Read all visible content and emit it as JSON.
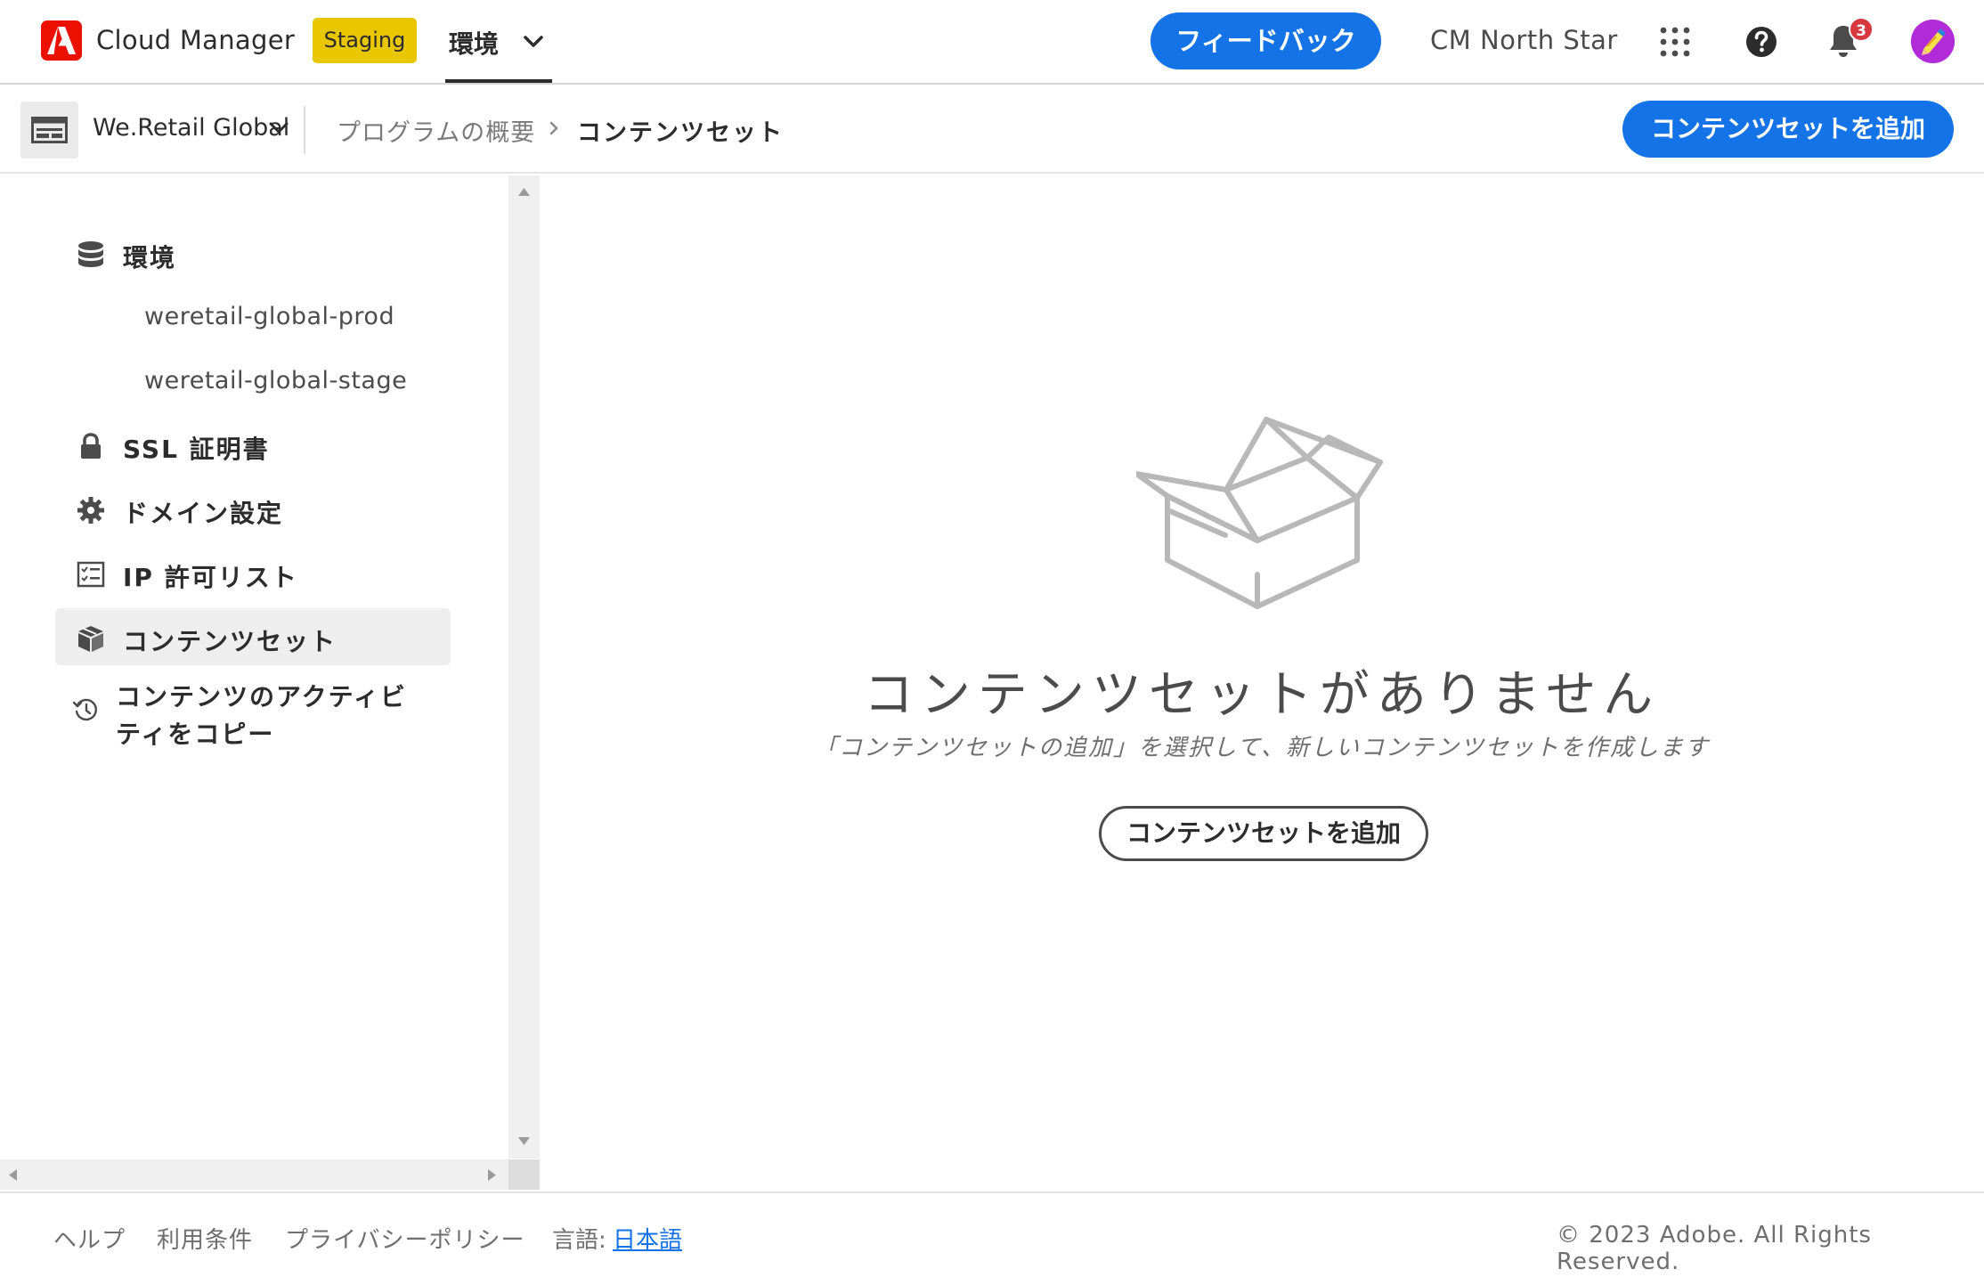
{
  "topbar": {
    "app_name": "Cloud Manager",
    "staging_badge": "Staging",
    "env_tab": "環境",
    "feedback_label": "フィードバック",
    "org_name": "CM North Star",
    "notification_count": "3",
    "icons": [
      "adobe-logo",
      "chevron-down-icon",
      "apps-grid-icon",
      "help-icon",
      "bell-icon",
      "avatar"
    ],
    "colors": {
      "brand_red": "#eb1000",
      "accent_blue": "#1473e6",
      "staging_yellow": "#e8c600",
      "badge_red": "#d7373f"
    }
  },
  "subheader": {
    "program_name": "We.Retail Global",
    "breadcrumb_parent": "プログラムの概要",
    "breadcrumb_current": "コンテンツセット",
    "add_button": "コンテンツセットを追加"
  },
  "sidebar": {
    "environments": {
      "label": "環境",
      "icon": "database-icon"
    },
    "env_items": [
      "weretail-global-prod",
      "weretail-global-stage"
    ],
    "ssl": {
      "label": "SSL 証明書",
      "icon": "lock-icon"
    },
    "domain": {
      "label": "ドメイン設定",
      "icon": "gear-icon"
    },
    "ip": {
      "label": "IP 許可リスト",
      "icon": "checklist-icon"
    },
    "content_sets": {
      "label": "コンテンツセット",
      "icon": "box-icon"
    },
    "copy_activity": {
      "label": "コンテンツのアクティビティをコピー",
      "icon": "history-icon"
    }
  },
  "main": {
    "empty_title": "コンテンツセットがありません",
    "empty_desc": "「コンテンツセットの追加」を選択して、新しいコンテンツセットを作成します",
    "empty_button": "コンテンツセットを追加"
  },
  "footer": {
    "help": "ヘルプ",
    "terms": "利用条件",
    "privacy": "プライバシーポリシー",
    "lang_label": "言語:",
    "lang_value": "日本語",
    "copyright": "© 2023 Adobe. All Rights Reserved."
  }
}
